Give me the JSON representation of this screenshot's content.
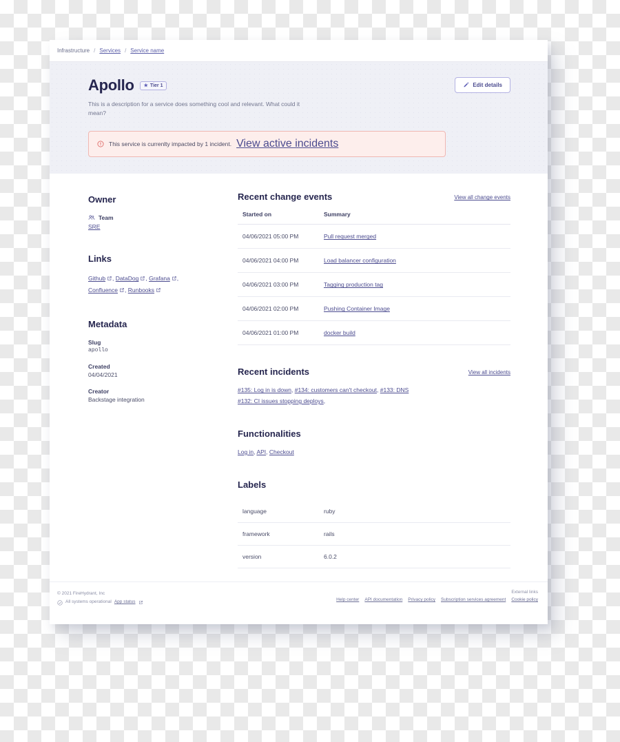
{
  "breadcrumb": {
    "root": "Infrastructure",
    "separator": "/",
    "items": [
      {
        "label": "Services"
      },
      {
        "label": "Service name"
      }
    ]
  },
  "header": {
    "title": "Apollo",
    "tier_badge": "Tier 1",
    "tier_star_icon": "star-icon",
    "description": "This is a description for a service does something cool and relevant. What could it mean?",
    "edit_button": "Edit details",
    "edit_icon": "pencil-icon"
  },
  "alert": {
    "icon": "exclamation-circle-icon",
    "message": "This service is currenlty impacted by 1 incident.",
    "link": "View active incidents",
    "border_color": "#f0b7b2",
    "background_color": "#fdeeec"
  },
  "sidebar": {
    "owner": {
      "title": "Owner",
      "icon": "team-icon",
      "label": "Team",
      "value": "SRE"
    },
    "links": {
      "title": "Links",
      "items": [
        {
          "label": "Github",
          "icon": "external-link-icon"
        },
        {
          "label": "DataDog",
          "icon": "external-link-icon"
        },
        {
          "label": "Grafana",
          "icon": "external-link-icon"
        },
        {
          "label": "Confluence",
          "icon": "external-link-icon"
        },
        {
          "label": "Runbooks",
          "icon": "external-link-icon"
        }
      ]
    },
    "metadata": {
      "title": "Metadata",
      "items": [
        {
          "key": "Slug",
          "value": "apollo",
          "mono": true
        },
        {
          "key": "Created",
          "value": "04/04/2021",
          "mono": false
        },
        {
          "key": "Creator",
          "value": "Backstage integration",
          "mono": false
        }
      ]
    }
  },
  "main": {
    "change_events": {
      "title": "Recent change events",
      "view_all": "View all change events",
      "columns": [
        "Started on",
        "Summary"
      ],
      "rows": [
        {
          "date": "04/06/2021 05:00 PM",
          "summary": "Pull request merged"
        },
        {
          "date": "04/06/2021 04:00 PM",
          "summary": "Load balancer configuration"
        },
        {
          "date": "04/06/2021 03:00 PM",
          "summary": "Tagging production tag"
        },
        {
          "date": "04/06/2021 02:00 PM",
          "summary": "Pushing Container Image"
        },
        {
          "date": "04/06/2021 01:00 PM",
          "summary": "docker build"
        }
      ]
    },
    "incidents": {
      "title": "Recent incidents",
      "view_all": "View all incidents",
      "items": [
        "#135: Log in is down",
        "#134: customers can't checkout",
        "#133: DNS",
        "#132: CI issues stopping deploys"
      ],
      "trailing_comma": ","
    },
    "functionalities": {
      "title": "Functionalities",
      "items": [
        "Log in",
        "API",
        "Checkout"
      ]
    },
    "labels": {
      "title": "Labels",
      "rows": [
        {
          "key": "language",
          "value": "ruby"
        },
        {
          "key": "framework",
          "value": "rails"
        },
        {
          "key": "version",
          "value": "6.0.2"
        }
      ]
    }
  },
  "footer": {
    "copyright": "© 2021 FireHydrant, Inc",
    "status_icon": "check-circle-icon",
    "status_text": "All systems operational",
    "app_status_link": "App status",
    "app_status_icon": "external-link-icon",
    "external_links_label": "External links",
    "links": [
      {
        "label": "Help center"
      },
      {
        "label": "API documentation"
      },
      {
        "label": "Privacy policy"
      },
      {
        "label": "Subscription services agreement"
      },
      {
        "label": "Cookie policy"
      }
    ]
  }
}
